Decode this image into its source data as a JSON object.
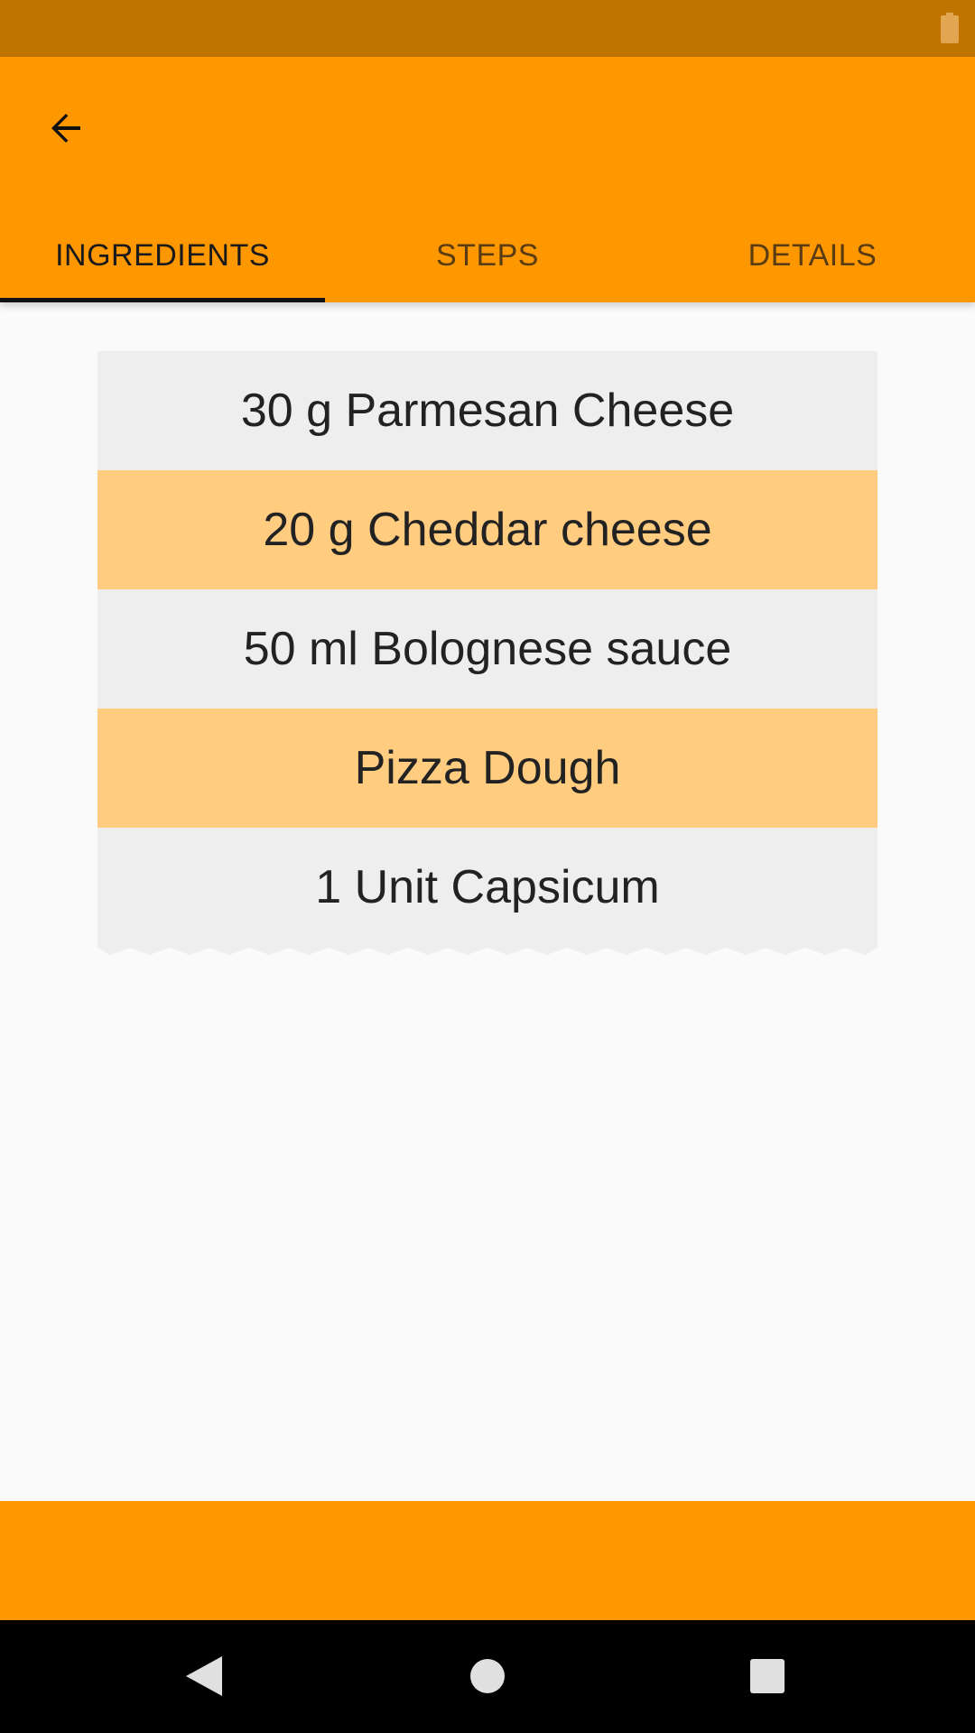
{
  "status_bar": {
    "battery_icon": "battery-icon"
  },
  "toolbar": {
    "back_icon": "arrow-left-icon"
  },
  "tabs": [
    {
      "label": "INGREDIENTS",
      "active": true
    },
    {
      "label": "STEPS",
      "active": false
    },
    {
      "label": "DETAILS",
      "active": false
    }
  ],
  "ingredients": [
    "30 g Parmesan Cheese",
    "20 g Cheddar cheese",
    "50 ml Bolognese sauce",
    "Pizza Dough",
    "1 Unit Capsicum"
  ],
  "navigation": {
    "back_icon": "triangle-back-icon",
    "home_icon": "circle-home-icon",
    "recents_icon": "square-recents-icon"
  },
  "colors": {
    "status_bar": "#c07400",
    "primary": "#ff9800",
    "row_light": "#eeeeee",
    "row_accent": "#ffcc80",
    "tab_indicator": "#111111"
  }
}
